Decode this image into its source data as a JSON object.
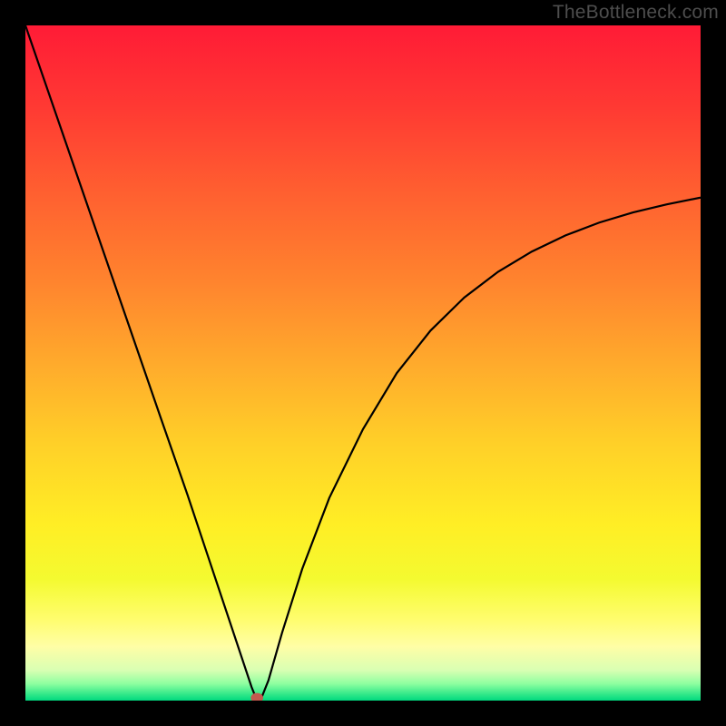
{
  "watermark": "TheBottleneck.com",
  "chart_data": {
    "type": "line",
    "title": "",
    "xlabel": "",
    "ylabel": "",
    "xlim": [
      0,
      100
    ],
    "ylim": [
      0,
      100
    ],
    "grid": false,
    "legend": "none",
    "series": [
      {
        "name": "bottleneck-curve",
        "x": [
          0,
          5,
          10,
          15,
          20,
          24,
          27,
          30,
          32,
          33.5,
          34.3,
          35,
          36,
          38,
          41,
          45,
          50,
          55,
          60,
          65,
          70,
          75,
          80,
          85,
          90,
          95,
          100
        ],
        "y": [
          100,
          85.5,
          71,
          56.5,
          42,
          30.5,
          21.5,
          12.5,
          6.5,
          2,
          0,
          0.5,
          3,
          10,
          19.5,
          30,
          40.2,
          48.5,
          54.8,
          59.7,
          63.5,
          66.5,
          68.9,
          70.8,
          72.3,
          73.5,
          74.5
        ]
      }
    ],
    "annotations": [
      {
        "name": "min-marker",
        "x": 34.3,
        "y": 0,
        "color": "#c35a4f"
      }
    ],
    "gradient_stops": [
      {
        "offset": 0.0,
        "color": "#ff1b36"
      },
      {
        "offset": 0.12,
        "color": "#ff3933"
      },
      {
        "offset": 0.25,
        "color": "#ff6030"
      },
      {
        "offset": 0.38,
        "color": "#ff842e"
      },
      {
        "offset": 0.5,
        "color": "#ffaa2c"
      },
      {
        "offset": 0.62,
        "color": "#ffd028"
      },
      {
        "offset": 0.74,
        "color": "#ffee25"
      },
      {
        "offset": 0.82,
        "color": "#f4fa30"
      },
      {
        "offset": 0.88,
        "color": "#fffd6e"
      },
      {
        "offset": 0.92,
        "color": "#fffea6"
      },
      {
        "offset": 0.955,
        "color": "#d9ffb3"
      },
      {
        "offset": 0.975,
        "color": "#8effa0"
      },
      {
        "offset": 0.99,
        "color": "#35e98a"
      },
      {
        "offset": 1.0,
        "color": "#00d97f"
      }
    ]
  }
}
